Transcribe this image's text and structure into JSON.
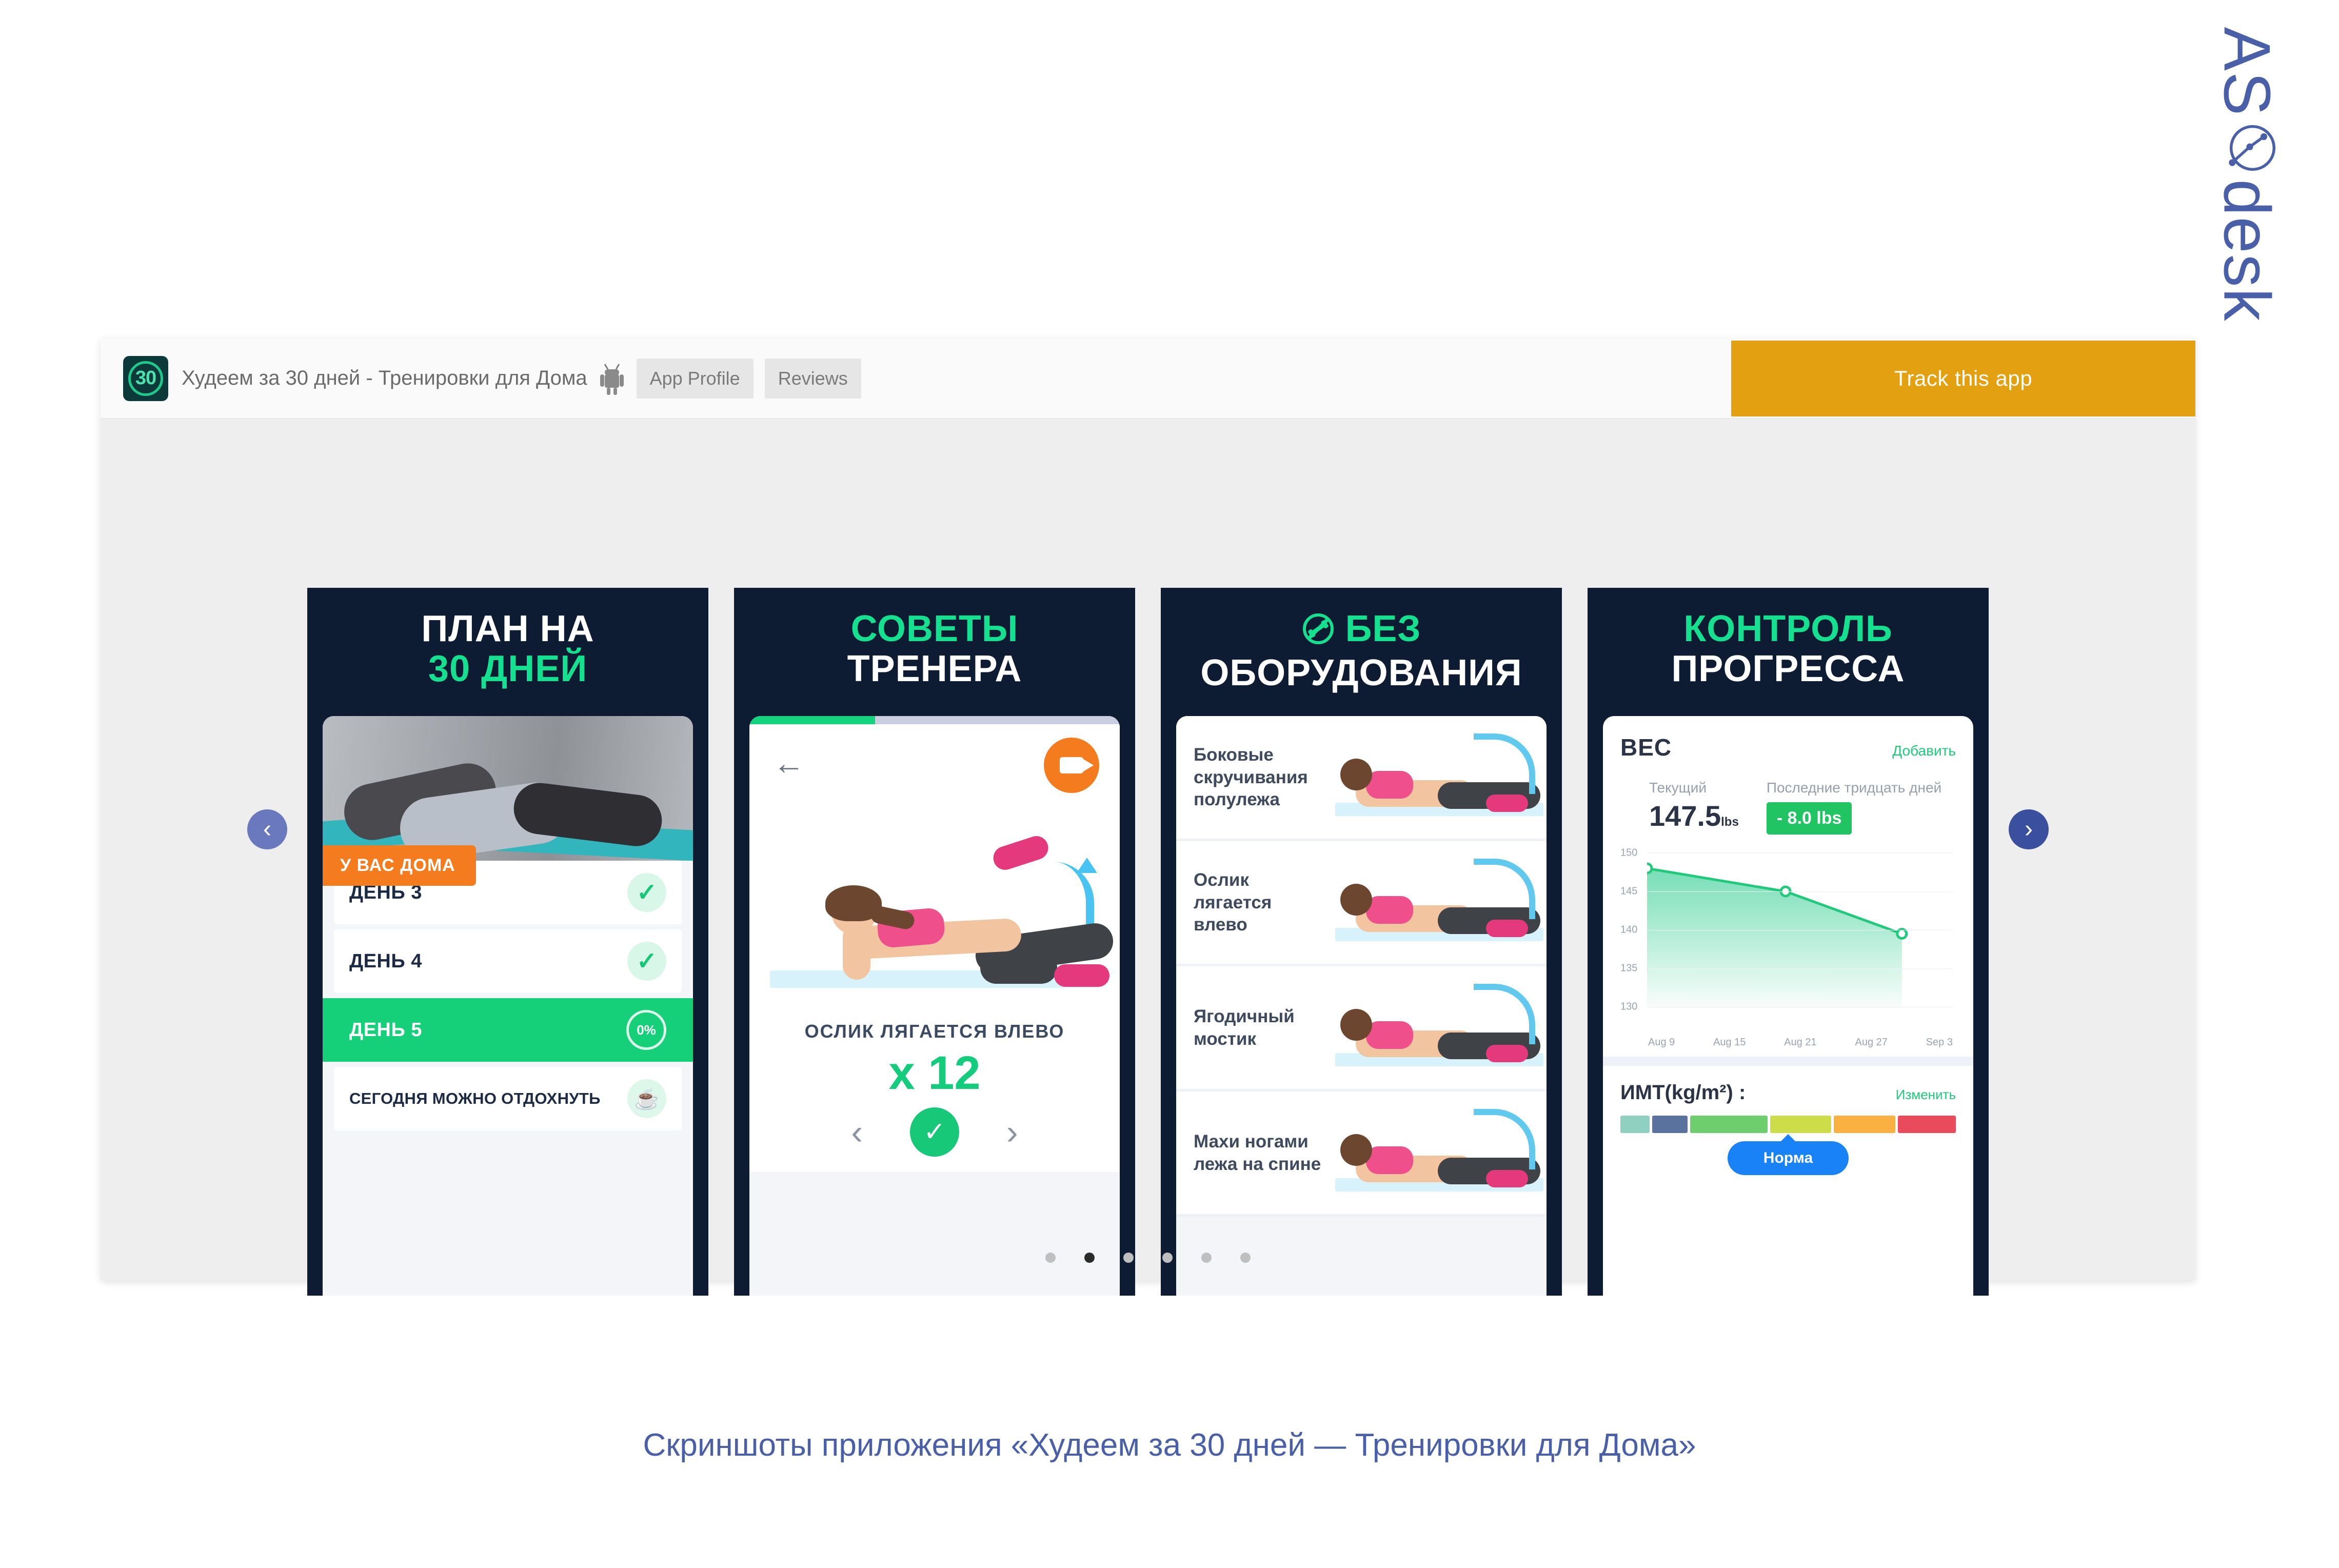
{
  "brand": {
    "logo_text": "ASdesk",
    "logo_mark": "circle-chart-icon",
    "color": "#4960a8"
  },
  "header": {
    "app_icon_text": "30",
    "app_title": "Худеем за 30 дней - Тренировки для Дома",
    "platform_icon": "android-icon",
    "tabs": [
      {
        "label": "App Profile"
      },
      {
        "label": "Reviews"
      }
    ],
    "track_button": "Track this app",
    "track_color": "#e3a010"
  },
  "gallery": {
    "prev_icon": "‹",
    "next_icon": "›",
    "dots_total": 6,
    "active_dot": 2
  },
  "screenshots": [
    {
      "title_line1": "ПЛАН НА",
      "title_line2": "30 ДНЕЙ",
      "title_line1_color": "white",
      "title_line2_color": "green",
      "badge": "У ВАС ДОМА",
      "badge_color": "#f57b1f",
      "days": [
        {
          "label": "ДЕНЬ 3",
          "state": "done",
          "check": "✓"
        },
        {
          "label": "ДЕНЬ 4",
          "state": "done",
          "check": "✓"
        },
        {
          "label": "ДЕНЬ 5",
          "state": "active",
          "progress": "0%"
        }
      ],
      "rest_label": "СЕГОДНЯ МОЖНО ОТДОХНУТЬ",
      "rest_icon": "cup-icon"
    },
    {
      "title_line1": "СОВЕТЫ",
      "title_line2": "ТРЕНЕРА",
      "title_line1_color": "green",
      "title_line2_color": "white",
      "back_icon": "←",
      "video_icon": "video-camera-icon",
      "exercise_name": "ОСЛИК ЛЯГАЕТСЯ ВЛЕВО",
      "reps": "x 12",
      "prev_icon": "‹",
      "next_icon": "›",
      "confirm_icon": "✓"
    },
    {
      "title_line1_icon": "no-equipment-icon",
      "title_line1": "БЕЗ",
      "title_line2": "ОБОРУДОВАНИЯ",
      "title_line1_color": "green",
      "title_line2_color": "white",
      "exercises": [
        {
          "name": "Боковые скручивания полулежа"
        },
        {
          "name": "Ослик лягается влево"
        },
        {
          "name": "Ягодичный мостик"
        },
        {
          "name": "Махи ногами лежа на спине"
        }
      ]
    },
    {
      "title_line1": "КОНТРОЛЬ",
      "title_line2": "ПРОГРЕССА",
      "title_line1_color": "green",
      "title_line2_color": "white",
      "weight_label": "ВЕС",
      "add_label": "Добавить",
      "current_caption": "Текущий",
      "current_value": "147.5",
      "current_unit": "lbs",
      "period_caption": "Последние тридцать дней",
      "delta_value": "- 8.0 lbs",
      "delta_color": "#21c462",
      "bmi_label": "ИМТ(kg/m²) :",
      "bmi_edit": "Изменить",
      "bmi_status": "Норма",
      "bmi_status_color": "#1a82f7",
      "bmi_segments": [
        {
          "color": "#8fd0c0",
          "width": 9
        },
        {
          "color": "#5a739e",
          "width": 11
        },
        {
          "color": "#6ece6e",
          "width": 24
        },
        {
          "color": "#cddc49",
          "width": 19
        },
        {
          "color": "#fbb042",
          "width": 19
        },
        {
          "color": "#ea4b5c",
          "width": 18
        }
      ]
    }
  ],
  "chart_data": {
    "type": "area",
    "title": "ВЕС",
    "xlabel": "",
    "ylabel": "lbs",
    "ylim": [
      130,
      150
    ],
    "yticks": [
      130,
      135,
      140,
      145,
      150
    ],
    "xticks": [
      "Aug 9",
      "Aug 15",
      "Aug 21",
      "Aug 27",
      "Sep 3"
    ],
    "grid": true,
    "legend": "none",
    "line_color": "#21c97b",
    "fill_color": "#7fe0b8",
    "x": [
      "Aug 9",
      "Aug 21",
      "Sep 1"
    ],
    "values": [
      148.0,
      145.0,
      139.5
    ],
    "annotations": {
      "current": "147.5 lbs",
      "change_30d": "- 8.0 lbs"
    }
  },
  "caption": "Скриншоты приложения «Худеем за 30 дней — Тренировки для Дома»"
}
